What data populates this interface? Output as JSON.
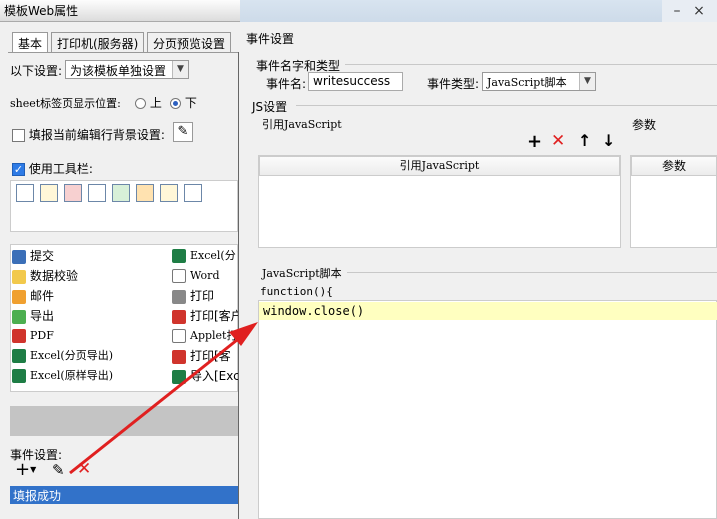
{
  "left_window": {
    "title": "模板Web属性",
    "tabs": [
      {
        "label": "基本"
      },
      {
        "label": "打印机(服务器)"
      },
      {
        "label": "分页预览设置"
      }
    ],
    "settings_label": "以下设置:",
    "settings_value": "为该模板单独设置",
    "sheet_tab_label": "sheet标签页显示位置:",
    "radio_top": "上",
    "radio_bottom": "下",
    "fill_bg_label": "填报当前编辑行背景设置:",
    "use_toolbar_label": "使用工具栏:",
    "buttons_left": [
      "提交",
      "数据校验",
      "邮件",
      "导出",
      "PDF",
      "Excel(分页导出)",
      "Excel(原样导出)"
    ],
    "buttons_right": [
      "Excel(分",
      "Word",
      "打印",
      "打印[客户",
      "Applet打",
      "打印[客",
      "导入[Exc"
    ],
    "event_label": "事件设置:",
    "event_item": "填报成功"
  },
  "right_window": {
    "title": "事件设置",
    "group_name_type": "事件名字和类型",
    "event_name_label": "事件名:",
    "event_name_value": "writesuccess",
    "event_type_label": "事件类型:",
    "event_type_value": "JavaScript脚本",
    "js_settings": "JS设置",
    "ref_js_label": "引用JavaScript",
    "params_label": "参数",
    "col_ref_js": "引用JavaScript",
    "col_params": "参数",
    "script_label": "JavaScript脚本",
    "function_header": "function(){",
    "code_line": "window.close()"
  },
  "colors": {
    "accent": "#2e7be6",
    "selection": "#3272c9",
    "code_highlight": "#ffffc0",
    "arrow": "#e02020"
  }
}
